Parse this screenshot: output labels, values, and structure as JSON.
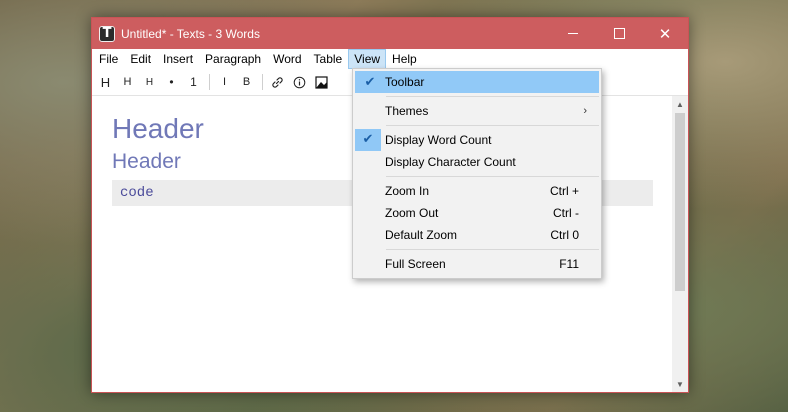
{
  "window": {
    "title": "Untitled* - Texts - 3 Words",
    "app_icon_letter": "T",
    "minimize_icon": "minimize-icon",
    "maximize_icon": "maximize-icon",
    "close_icon": "close-icon",
    "accent": "#cd5d5f"
  },
  "menubar": {
    "items": [
      "File",
      "Edit",
      "Insert",
      "Paragraph",
      "Word",
      "Table",
      "View",
      "Help"
    ],
    "active": "View"
  },
  "toolbar": {
    "h1": "H",
    "h2": "H",
    "h3": "H",
    "bullet": "•",
    "numbered": "1",
    "italic": "I",
    "bold": "B"
  },
  "document": {
    "heading1": "Header",
    "heading2": "Header",
    "code": "code",
    "heading_color": "#7078b7"
  },
  "view_menu": {
    "toolbar": "Toolbar",
    "themes": "Themes",
    "display_word_count": "Display Word Count",
    "display_character_count": "Display Character Count",
    "zoom_in": "Zoom In",
    "zoom_in_shortcut": "Ctrl +",
    "zoom_out": "Zoom Out",
    "zoom_out_shortcut": "Ctrl -",
    "default_zoom": "Default Zoom",
    "default_zoom_shortcut": "Ctrl 0",
    "full_screen": "Full Screen",
    "full_screen_shortcut": "F11",
    "checked_items": [
      "Toolbar",
      "Display Word Count"
    ],
    "highlight_color": "#91c9f7"
  }
}
